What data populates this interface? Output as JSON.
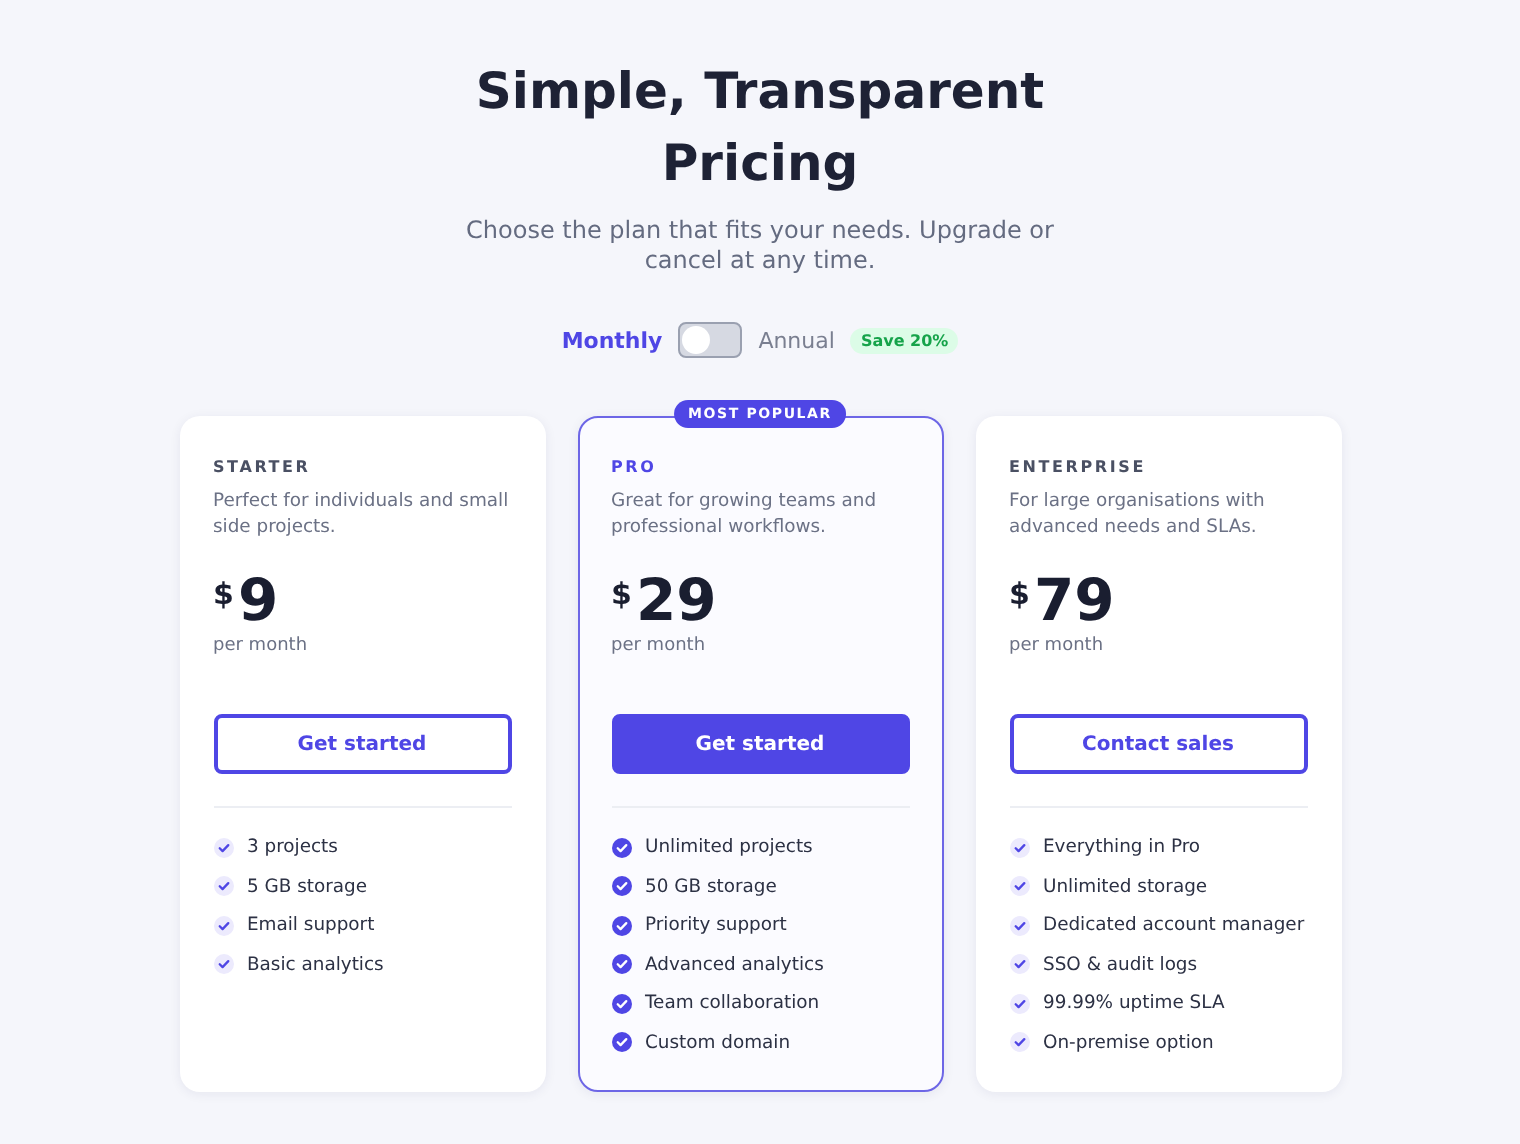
{
  "header": {
    "title": "Simple, Transparent Pricing",
    "subtitle": "Choose the plan that fits your needs. Upgrade or cancel at any time."
  },
  "billing": {
    "options": [
      {
        "label": "Monthly",
        "selected": true
      },
      {
        "label": "Annual",
        "selected": false
      }
    ],
    "toggle_on": false,
    "badge": "Save 20%"
  },
  "plans": [
    {
      "name": "STARTER",
      "description": "Perfect for individuals and small side projects.",
      "currency": "$",
      "price": "9",
      "period": "per month",
      "featured": false,
      "button": "Get started",
      "features": [
        "3 projects",
        "5 GB storage",
        "Email support",
        "Basic analytics"
      ]
    },
    {
      "name": "PRO",
      "badge": "MOST POPULAR",
      "description": "Great for growing teams and professional workflows.",
      "currency": "$",
      "price": "29",
      "period": "per month",
      "featured": true,
      "button": "Get started",
      "features": [
        "Unlimited projects",
        "50 GB storage",
        "Priority support",
        "Advanced analytics",
        "Team collaboration",
        "Custom domain"
      ]
    },
    {
      "name": "ENTERPRISE",
      "description": "For large organisations with advanced needs and SLAs.",
      "currency": "$",
      "price": "79",
      "period": "per month",
      "featured": false,
      "button": "Contact sales",
      "features": [
        "Everything in Pro",
        "Unlimited storage",
        "Dedicated account manager",
        "SSO & audit logs",
        "99.99% uptime SLA",
        "On-premise option"
      ]
    }
  ]
}
